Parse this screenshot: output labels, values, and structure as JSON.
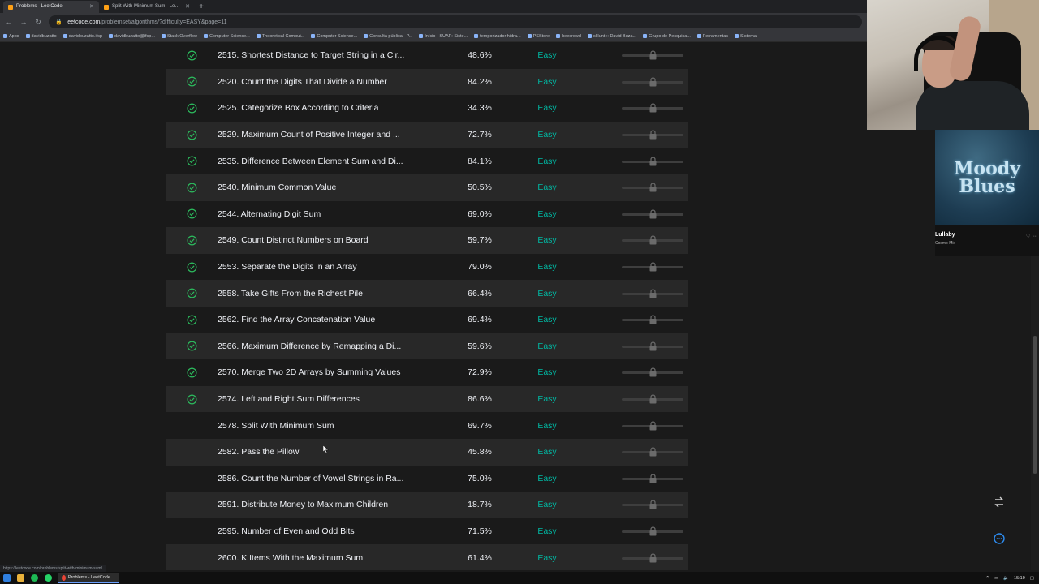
{
  "browser": {
    "tabs": [
      {
        "title": "Problems - LeetCode",
        "active": true
      },
      {
        "title": "Split With Minimum Sum - LeetC",
        "active": false
      }
    ],
    "new_tab_label": "+",
    "url_host": "leetcode.com",
    "url_path": "/problemset/algorithms/?difficulty=EASY&page=11",
    "bookmarks": [
      "Apps",
      "davidbuzatto",
      "davidbuzatto.ifsp",
      "davidbuzatto@ifsp...",
      "Stack Overflow",
      "Computer Science...",
      "Theoretical Comput...",
      "Computer Science...",
      "Consulta pública - P...",
      "Início - SUAP: Siste...",
      "temporizador hidra...",
      "PSStore",
      "beecrowd",
      "sHunt :: David Buza...",
      "Grupo de Pesquisa...",
      "Ferramentas",
      "Sistema"
    ]
  },
  "problems": [
    {
      "title": "2515. Shortest Distance to Target String in a Cir...",
      "acceptance": "48.6%",
      "difficulty": "Easy",
      "solved": true
    },
    {
      "title": "2520. Count the Digits That Divide a Number",
      "acceptance": "84.2%",
      "difficulty": "Easy",
      "solved": true
    },
    {
      "title": "2525. Categorize Box According to Criteria",
      "acceptance": "34.3%",
      "difficulty": "Easy",
      "solved": true
    },
    {
      "title": "2529. Maximum Count of Positive Integer and ...",
      "acceptance": "72.7%",
      "difficulty": "Easy",
      "solved": true
    },
    {
      "title": "2535. Difference Between Element Sum and Di...",
      "acceptance": "84.1%",
      "difficulty": "Easy",
      "solved": true
    },
    {
      "title": "2540. Minimum Common Value",
      "acceptance": "50.5%",
      "difficulty": "Easy",
      "solved": true
    },
    {
      "title": "2544. Alternating Digit Sum",
      "acceptance": "69.0%",
      "difficulty": "Easy",
      "solved": true
    },
    {
      "title": "2549. Count Distinct Numbers on Board",
      "acceptance": "59.7%",
      "difficulty": "Easy",
      "solved": true
    },
    {
      "title": "2553. Separate the Digits in an Array",
      "acceptance": "79.0%",
      "difficulty": "Easy",
      "solved": true
    },
    {
      "title": "2558. Take Gifts From the Richest Pile",
      "acceptance": "66.4%",
      "difficulty": "Easy",
      "solved": true
    },
    {
      "title": "2562. Find the Array Concatenation Value",
      "acceptance": "69.4%",
      "difficulty": "Easy",
      "solved": true
    },
    {
      "title": "2566. Maximum Difference by Remapping a Di...",
      "acceptance": "59.6%",
      "difficulty": "Easy",
      "solved": true
    },
    {
      "title": "2570. Merge Two 2D Arrays by Summing Values",
      "acceptance": "72.9%",
      "difficulty": "Easy",
      "solved": true
    },
    {
      "title": "2574. Left and Right Sum Differences",
      "acceptance": "86.6%",
      "difficulty": "Easy",
      "solved": true
    },
    {
      "title": "2578. Split With Minimum Sum",
      "acceptance": "69.7%",
      "difficulty": "Easy",
      "solved": false
    },
    {
      "title": "2582. Pass the Pillow",
      "acceptance": "45.8%",
      "difficulty": "Easy",
      "solved": false
    },
    {
      "title": "2586. Count the Number of Vowel Strings in Ra...",
      "acceptance": "75.0%",
      "difficulty": "Easy",
      "solved": false
    },
    {
      "title": "2591. Distribute Money to Maximum Children",
      "acceptance": "18.7%",
      "difficulty": "Easy",
      "solved": false
    },
    {
      "title": "2595. Number of Even and Odd Bits",
      "acceptance": "71.5%",
      "difficulty": "Easy",
      "solved": false
    },
    {
      "title": "2600. K Items With the Maximum Sum",
      "acceptance": "61.4%",
      "difficulty": "Easy",
      "solved": false
    }
  ],
  "colors": {
    "easy": "#00b8a3",
    "check": "#2cbb5d",
    "row_alt": "#282828",
    "background": "#1a1a1a"
  },
  "music": {
    "album_line1": "Moody",
    "album_line2": "Blues",
    "track": "Lullaby",
    "artist": "Cosmo Mix"
  },
  "status_link": "https://leetcode.com/problems/split-with-minimum-sum/",
  "taskbar": {
    "app_label": "Problems - LeetCode ...",
    "clock": "15:19"
  },
  "icons": {
    "solved": "check-circle-icon",
    "frequency": "lock-icon",
    "fab_top": "swap-icon",
    "fab_bottom": "chat-icon"
  }
}
